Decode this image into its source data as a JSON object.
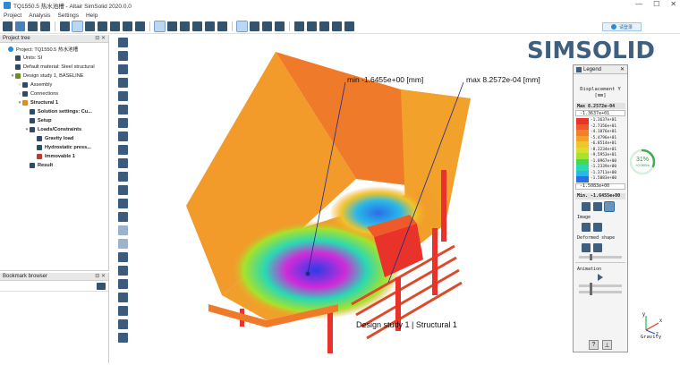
{
  "window": {
    "title": "TQ1550.5 热水池槽 - Altair SimSolid 2020.0.0",
    "controls": [
      "—",
      "☐",
      "✕"
    ]
  },
  "menu": [
    "Project",
    "Analysis",
    "Settings",
    "Help"
  ],
  "login_button": "请登录",
  "project_tree": {
    "header": "Project tree",
    "items": [
      {
        "label": "Project: TQ1550.5 热水池槽",
        "indent": 0,
        "arrow": "",
        "icon": "s"
      },
      {
        "label": "Units: SI",
        "indent": 1,
        "arrow": "",
        "icon": "n"
      },
      {
        "label": "Default material: Steel structural",
        "indent": 1,
        "arrow": "",
        "icon": "n"
      },
      {
        "label": "Design study 1, BASELINE",
        "indent": 1,
        "arrow": "▾",
        "icon": "g"
      },
      {
        "label": "Assembly",
        "indent": 2,
        "arrow": "›",
        "icon": "n"
      },
      {
        "label": "Connections",
        "indent": 2,
        "arrow": "›",
        "icon": "n"
      },
      {
        "label": "Structural 1",
        "indent": 2,
        "arrow": "▾",
        "icon": "o",
        "bold": true
      },
      {
        "label": "Solution settings: Cu...",
        "indent": 3,
        "arrow": "",
        "icon": "n",
        "bold": true
      },
      {
        "label": "Setup",
        "indent": 3,
        "arrow": "",
        "icon": "n",
        "bold": true
      },
      {
        "label": "Loads/Constraints",
        "indent": 3,
        "arrow": "▾",
        "icon": "n",
        "bold": true
      },
      {
        "label": "Gravity load",
        "indent": 4,
        "arrow": "",
        "icon": "n",
        "bold": true
      },
      {
        "label": "Hydrostatic press...",
        "indent": 4,
        "arrow": "",
        "icon": "n",
        "bold": true
      },
      {
        "label": "Immovable 1",
        "indent": 4,
        "arrow": "",
        "icon": "r",
        "bold": true
      },
      {
        "label": "Result",
        "indent": 3,
        "arrow": "",
        "icon": "n",
        "bold": true
      }
    ]
  },
  "bookmark_browser": {
    "header": "Bookmark browser"
  },
  "brand": "SIMSOLID",
  "viewport": {
    "min_label": "min  -1.6455e+00  [mm]",
    "max_label": "max  8.2572e-04  [mm]",
    "caption": "Design study 1 | Structural  1"
  },
  "legend": {
    "header": "Legend",
    "title_line1": "Displacement Y",
    "title_line2": "[mm]",
    "max_text": "Max  8.2572e-04",
    "top_value": "-1.3637e+01",
    "bottom_value": "-1.5083e+00",
    "min_text": "Min. -1.6455e+00",
    "scale": [
      {
        "color": "#e8322a",
        "label": "-1.3637e+01"
      },
      {
        "color": "#ee5a2a",
        "label": "-2.7356e+01"
      },
      {
        "color": "#f2802a",
        "label": "-4.1076e+01"
      },
      {
        "color": "#f2a22a",
        "label": "-5.4796e+01"
      },
      {
        "color": "#eec52a",
        "label": "-6.8514e+01"
      },
      {
        "color": "#d8de2a",
        "label": "-8.2234e+01"
      },
      {
        "color": "#a8e22a",
        "label": "-9.5953e+01"
      },
      {
        "color": "#4cd844",
        "label": "-1.0967e+00"
      },
      {
        "color": "#2ad8b4",
        "label": "-1.2339e+00"
      },
      {
        "color": "#2ab8e8",
        "label": "-1.3711e+00"
      },
      {
        "color": "#2a6ee8",
        "label": "-1.5083e+00"
      }
    ],
    "image_label": "Image",
    "deformed_label": "Deformed shape",
    "animation_label": "Animation",
    "help": "?"
  },
  "progress": {
    "percent": "31%",
    "rate": "+0.0KB/s",
    "fraction": 0.31
  },
  "triad": {
    "label": "Gravity"
  }
}
